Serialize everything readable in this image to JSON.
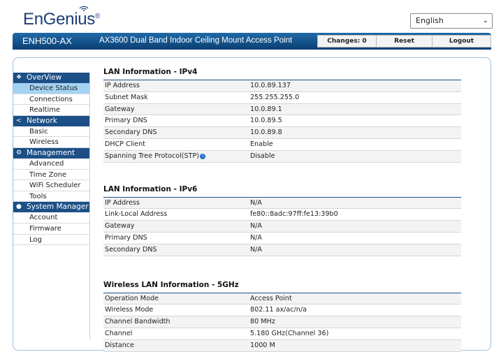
{
  "header": {
    "logo": "EnGenius",
    "logo_mark": "®",
    "language": "English",
    "model": "ENH500-AX",
    "description": "AX3600 Dual Band Indoor Ceiling Mount Access Point",
    "buttons": {
      "changes": "Changes: 0",
      "reset": "Reset",
      "logout": "Logout"
    }
  },
  "sidebar": {
    "sections": [
      {
        "label": "OverView",
        "icon": "info-icon",
        "items": [
          "Device Status",
          "Connections",
          "Realtime"
        ]
      },
      {
        "label": "Network",
        "icon": "share-icon",
        "items": [
          "Basic",
          "Wireless"
        ]
      },
      {
        "label": "Management",
        "icon": "gear-icon",
        "items": [
          "Advanced",
          "Time Zone",
          "WiFi Scheduler",
          "Tools"
        ]
      },
      {
        "label": "System Manager",
        "icon": "user-icon",
        "items": [
          "Account",
          "Firmware",
          "Log"
        ]
      }
    ],
    "active_item": "Device Status"
  },
  "lan_ipv4": {
    "title": "LAN Information - IPv4",
    "rows": [
      [
        "IP Address",
        "10.0.89.137"
      ],
      [
        "Subnet Mask",
        "255.255.255.0"
      ],
      [
        "Gateway",
        "10.0.89.1"
      ],
      [
        "Primary DNS",
        "10.0.89.5"
      ],
      [
        "Secondary DNS",
        "10.0.89.8"
      ],
      [
        "DHCP Client",
        "Enable"
      ],
      [
        "Spanning Tree Protocol(STP)",
        "Disable"
      ]
    ]
  },
  "lan_ipv6": {
    "title": "LAN Information - IPv6",
    "rows": [
      [
        "IP Address",
        "N/A"
      ],
      [
        "Link-Local Address",
        "fe80::8adc:97ff:fe13:39b0"
      ],
      [
        "Gateway",
        "N/A"
      ],
      [
        "Primary DNS",
        "N/A"
      ],
      [
        "Secondary DNS",
        "N/A"
      ]
    ]
  },
  "wlan_5g": {
    "title": "Wireless LAN Information - 5GHz",
    "rows": [
      [
        "Operation Mode",
        "Access Point"
      ],
      [
        "Wireless Mode",
        "802.11 ax/ac/n/a"
      ],
      [
        "Channel Bandwidth",
        "80 MHz"
      ],
      [
        "Channel",
        "5.180 GHz(Channel 36)"
      ],
      [
        "Distance",
        "1000 M"
      ]
    ]
  }
}
